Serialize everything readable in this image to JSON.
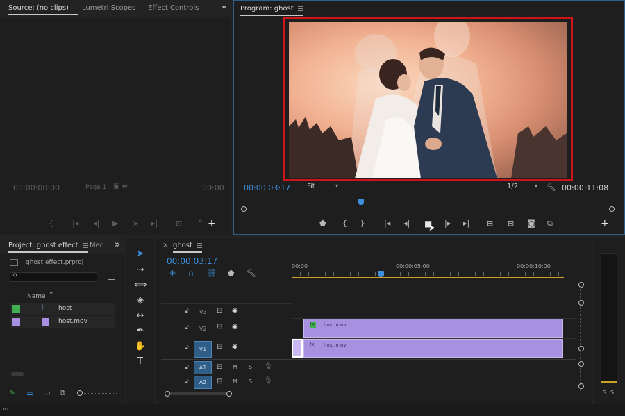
{
  "source_panel": {
    "tabs": [
      "Source: (no clips)",
      "Lumetri Scopes",
      "Effect Controls"
    ],
    "timecode_left": "00:00:00:00",
    "page_label": "Page 1",
    "timecode_right": "00:00",
    "overflow": "»"
  },
  "program_panel": {
    "title": "Program: ghost",
    "timecode_current": "00:00:03:17",
    "fit_label": "Fit",
    "resolution": "1/2",
    "timecode_duration": "00:00:11:08"
  },
  "project_panel": {
    "tab_label": "Project: ghost effect",
    "tab_secondary": "Mec",
    "overflow": "»",
    "project_file": "ghost effect.prproj",
    "column_name": "Name",
    "items": [
      {
        "name": "host",
        "color": "#3fb04f"
      },
      {
        "name": "host.mov",
        "color": "#a890e0"
      }
    ]
  },
  "timeline": {
    "sequence_name": "ghost",
    "timecode": "00:00:03:17",
    "ruler": [
      "00:00",
      "00:00:05:00",
      "00:00:10:00"
    ],
    "tracks": {
      "v3": "V3",
      "v2": "V2",
      "v1": "V1",
      "a1": "A1",
      "a2": "A2",
      "mute": "M",
      "solo": "S"
    },
    "clip_v2": "host.mov",
    "clip_v1": "host.mov"
  },
  "meter": {
    "solo_left": "S",
    "solo_right": "S"
  },
  "colors": {
    "accent": "#3d8edb",
    "clip": "#a890e0",
    "highlight_frame": "#d0141c",
    "playhead": "#3d8edb"
  }
}
